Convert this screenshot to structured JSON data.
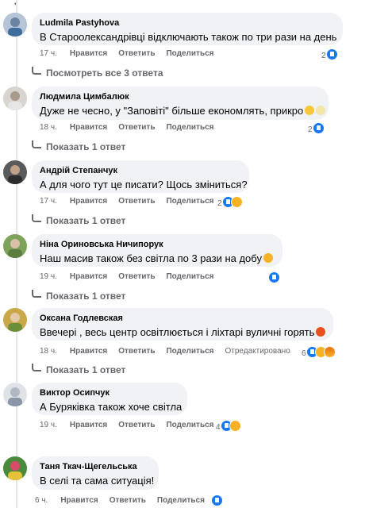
{
  "comments": [
    {
      "author": "Ludmila Pastyhova",
      "text": "В Староолександрівці відключають також по три рази на день",
      "time": "17 ч.",
      "react_count": "2",
      "replies_link": "Посмотреть все 3 ответа"
    },
    {
      "author": "Людмила Цимбалюк",
      "text": "Дуже не чесно, у \"Заповіті\" більше економлять, прикро",
      "time": "18 ч.",
      "react_count": "2",
      "replies_link": "Показать 1 ответ"
    },
    {
      "author": "Андрій Степанчук",
      "text": "А для чого тут це писати? Щось зміниться?",
      "time": "17 ч.",
      "react_count": "2",
      "replies_link": "Показать 1 ответ"
    },
    {
      "author": "Ніна Ориновська Ничипорук",
      "text": "Наш масив також без світла по 3 рази на добу",
      "time": "19 ч.",
      "react_count": "",
      "replies_link": "Показать 1 ответ"
    },
    {
      "author": "Оксана Годлевская",
      "text": "Ввечері , весь центр освітлюється і ліхтарі вуличні горять",
      "time": "18 ч.",
      "react_count": "6",
      "edited": "Отредактировано",
      "replies_link": "Показать 1 ответ"
    },
    {
      "author": "Виктор Осипчук",
      "text": "А Буряківка також хоче світла",
      "time": "19 ч.",
      "react_count": "4",
      "replies_link": ""
    },
    {
      "author": "Таня Ткач-Щегельська",
      "text": "В селі та сама ситуація!",
      "time": "6 ч.",
      "react_count": "",
      "replies_link": ""
    }
  ],
  "actions": {
    "like": "Нравится",
    "reply": "Ответить",
    "share": "Поделиться"
  },
  "colors": {
    "bubble": "#f0f2f5",
    "meta": "#65676b",
    "like_blue": "#1877f2"
  }
}
